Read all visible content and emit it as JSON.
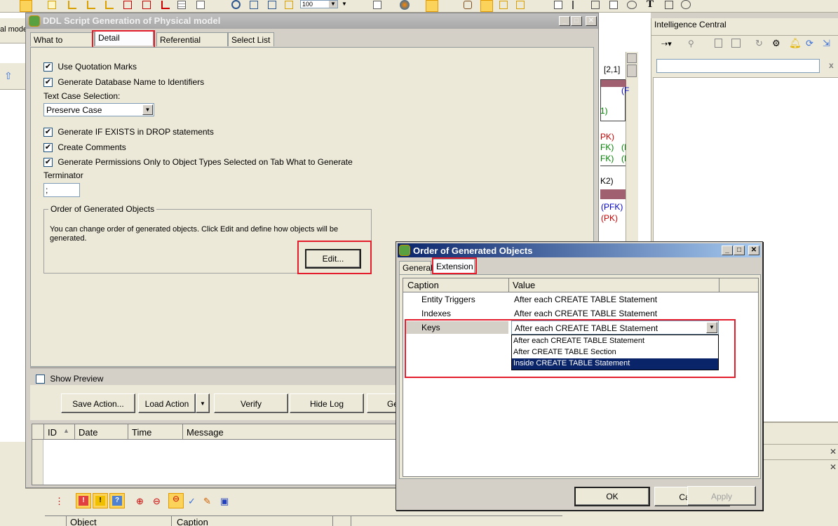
{
  "background_app": {
    "left_label": "al mode",
    "toolbar_zoom_value": "100",
    "diagram_fragments": [
      "[2,1]",
      "(F",
      "1)",
      "PK)",
      "FK)",
      "(I",
      "FK)",
      "(I",
      "K2)",
      "(PFK)",
      "(PK)"
    ]
  },
  "intelligence_central": {
    "title": "Intelligence Central",
    "search_value": "",
    "close_label": "x"
  },
  "ddl_window": {
    "title": "DDL Script Generation of Physical model",
    "tabs": [
      "What to Generate",
      "Detail Settings",
      "Referential Integrity",
      "Select List"
    ],
    "active_tab_index": 1,
    "options": {
      "use_quotation_marks": "Use Quotation Marks",
      "generate_db_name": "Generate Database Name to Identifiers",
      "text_case_label": "Text Case Selection:",
      "text_case_value": "Preserve Case",
      "if_exists": "Generate IF EXISTS in DROP statements",
      "create_comments": "Create Comments",
      "permissions_only": "Generate Permissions Only to Object Types Selected on Tab What to Generate",
      "terminator_label": "Terminator",
      "terminator_value": ";"
    },
    "order_group": {
      "title": "Order of Generated Objects",
      "description": "You can change order of generated objects. Click Edit and define how objects will be generated.",
      "edit_button": "Edit..."
    },
    "show_preview": "Show Preview",
    "actions": {
      "save_action": "Save Action...",
      "load_action": "Load Action",
      "verify": "Verify",
      "hide_log": "Hide Log",
      "generate_partial": "Ge"
    },
    "log_columns": [
      "ID",
      "Date",
      "Time",
      "Message"
    ]
  },
  "bottom_panel": {
    "columns": [
      "Object",
      "Caption"
    ]
  },
  "order_dialog": {
    "title": "Order of Generated Objects",
    "tabs": [
      "General",
      "Extension"
    ],
    "active_tab_index": 1,
    "columns": [
      "Caption",
      "Value"
    ],
    "rows": [
      {
        "caption": "Entity Triggers",
        "value": "After each CREATE TABLE Statement"
      },
      {
        "caption": "Indexes",
        "value": "After each CREATE TABLE Statement"
      },
      {
        "caption": "Keys",
        "value": "After each CREATE TABLE Statement"
      }
    ],
    "dropdown_options": [
      "After each CREATE TABLE Statement",
      "After CREATE TABLE Section",
      "Inside CREATE TABLE Statement"
    ],
    "dropdown_highlighted_index": 2,
    "buttons": {
      "ok": "OK",
      "cancel": "Cancel",
      "apply": "Apply"
    }
  },
  "colors": {
    "highlight_red": "#e31d2b",
    "selection_blue": "#0a246a",
    "pk_red": "#cc0000",
    "fk_green": "#008000",
    "pfk_blue": "#0000cc"
  }
}
